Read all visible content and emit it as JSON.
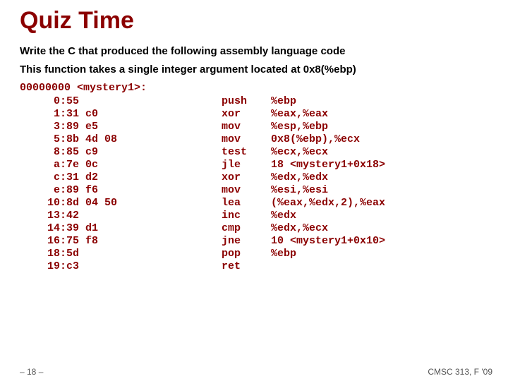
{
  "title": "Quiz Time",
  "intro1": "Write the C that produced the following assembly language code",
  "intro2": "This function takes a single integer argument located at 0x8(%ebp)",
  "symhdr": "00000000 <mystery1>:",
  "rows": [
    {
      "addr": "0:",
      "bytes": "55",
      "mnem": "push",
      "ops": "%ebp"
    },
    {
      "addr": "1:",
      "bytes": "31 c0",
      "mnem": "xor",
      "ops": "%eax,%eax"
    },
    {
      "addr": "3:",
      "bytes": "89 e5",
      "mnem": "mov",
      "ops": "%esp,%ebp"
    },
    {
      "addr": "5:",
      "bytes": "8b 4d 08",
      "mnem": "mov",
      "ops": "0x8(%ebp),%ecx"
    },
    {
      "addr": "8:",
      "bytes": "85 c9",
      "mnem": "test",
      "ops": "%ecx,%ecx"
    },
    {
      "addr": "a:",
      "bytes": "7e 0c",
      "mnem": "jle",
      "ops": "18 <mystery1+0x18>"
    },
    {
      "addr": "c:",
      "bytes": "31 d2",
      "mnem": "xor",
      "ops": "%edx,%edx"
    },
    {
      "addr": "e:",
      "bytes": "89 f6",
      "mnem": "mov",
      "ops": "%esi,%esi"
    },
    {
      "addr": "10:",
      "bytes": "8d 04 50",
      "mnem": "lea",
      "ops": "(%eax,%edx,2),%eax"
    },
    {
      "addr": "13:",
      "bytes": "42",
      "mnem": "inc",
      "ops": "%edx"
    },
    {
      "addr": "14:",
      "bytes": "39 d1",
      "mnem": "cmp",
      "ops": "%edx,%ecx"
    },
    {
      "addr": "16:",
      "bytes": "75 f8",
      "mnem": "jne",
      "ops": "10 <mystery1+0x10>"
    },
    {
      "addr": "18:",
      "bytes": "5d",
      "mnem": "pop",
      "ops": "%ebp"
    },
    {
      "addr": "19:",
      "bytes": "c3",
      "mnem": "ret",
      "ops": ""
    }
  ],
  "footer_left": "– 18 –",
  "footer_right": "CMSC 313, F '09"
}
